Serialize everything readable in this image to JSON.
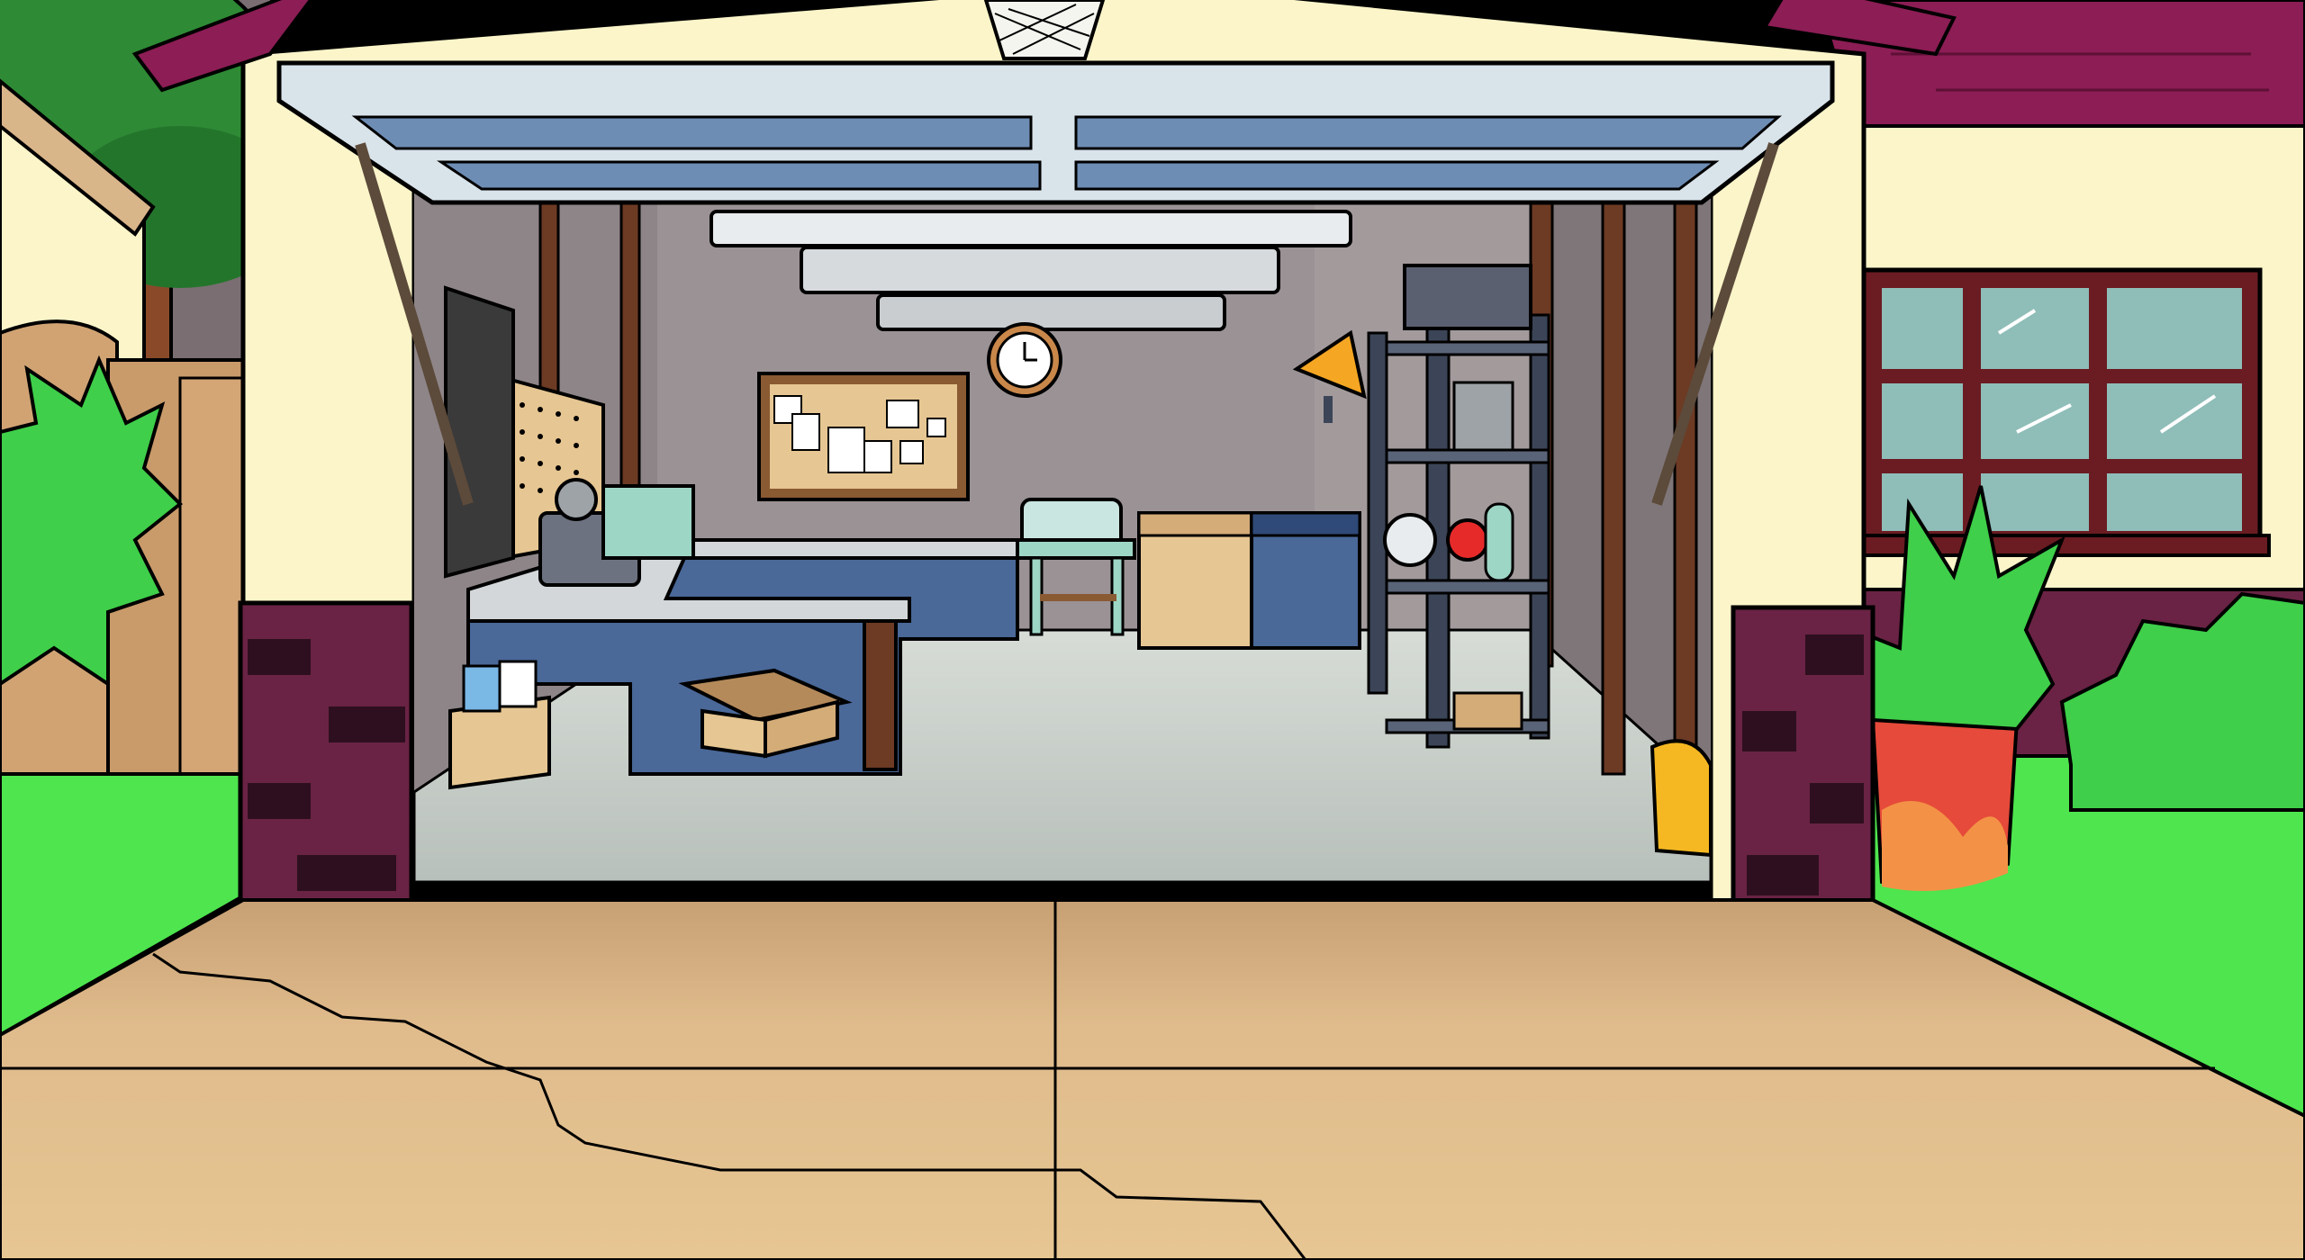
{
  "scene": {
    "name": "garage",
    "interactables": [
      "basketball-hoop-net",
      "garage-door",
      "cork-board",
      "wall-clock",
      "pegboard",
      "workbench",
      "power-tool",
      "cardboard-box",
      "open-box",
      "sink",
      "washing-machine",
      "dryer",
      "storage-shelf",
      "orange-lamp",
      "puffle-statue",
      "hockey-bell",
      "window"
    ]
  },
  "colors": {
    "grass": "#4ee54e",
    "wall_cream": "#fbf5c9",
    "roof_magenta": "#8c1d55",
    "brick": "#6a2344",
    "driveway": "#dcb585",
    "garage_floor": "#c9cfca",
    "garage_wall": "#a39a9c",
    "door_panel": "#6e8db4",
    "counter_blue": "#4a6898",
    "window_glass": "#8fbdb8",
    "window_frame": "#6a1c22"
  }
}
